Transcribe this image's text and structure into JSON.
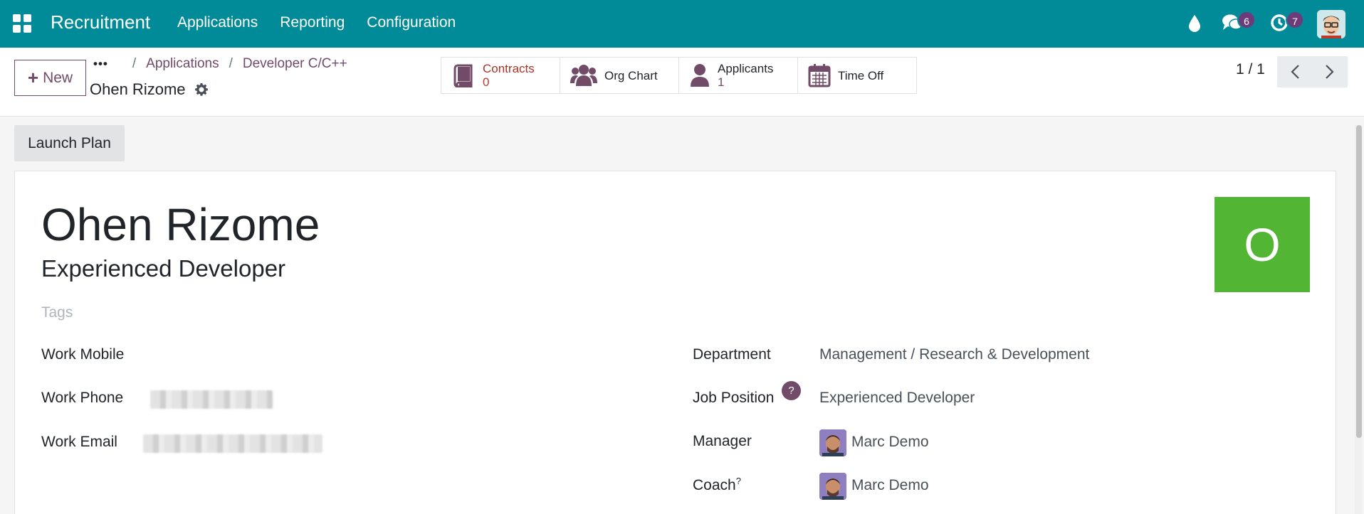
{
  "navbar": {
    "brand": "Recruitment",
    "menu": [
      "Applications",
      "Reporting",
      "Configuration"
    ],
    "messages_badge": "6",
    "activities_badge": "7"
  },
  "control_panel": {
    "new_label": "New",
    "breadcrumbs": [
      "Applications",
      "Developer C/C++"
    ],
    "record_title": "Ohen Rizome",
    "smart_buttons": [
      {
        "label": "Contracts",
        "value": "0",
        "icon": "book-icon"
      },
      {
        "label": "Org Chart",
        "value": "",
        "icon": "users-icon"
      },
      {
        "label": "Applicants",
        "value": "1",
        "icon": "user-icon"
      },
      {
        "label": "Time Off",
        "value": "",
        "icon": "calendar-icon"
      }
    ],
    "pager": "1 / 1"
  },
  "form": {
    "launch_plan": "Launch Plan",
    "name": "Ohen Rizome",
    "job_title": "Experienced Developer",
    "tags_placeholder": "Tags",
    "avatar_initial": "O",
    "left_fields": {
      "work_mobile_label": "Work Mobile",
      "work_phone_label": "Work Phone",
      "work_email_label": "Work Email"
    },
    "right_fields": {
      "department_label": "Department",
      "department_value": "Management / Research & Development",
      "job_position_label": "Job Position",
      "job_position_value": "Experienced Developer",
      "manager_label": "Manager",
      "manager_value": "Marc Demo",
      "coach_label": "Coach",
      "coach_value": "Marc Demo"
    },
    "help_marker": "?"
  },
  "colors": {
    "navbar": "#018b98",
    "accent": "#714b67",
    "avatar_bg": "#52b534"
  }
}
